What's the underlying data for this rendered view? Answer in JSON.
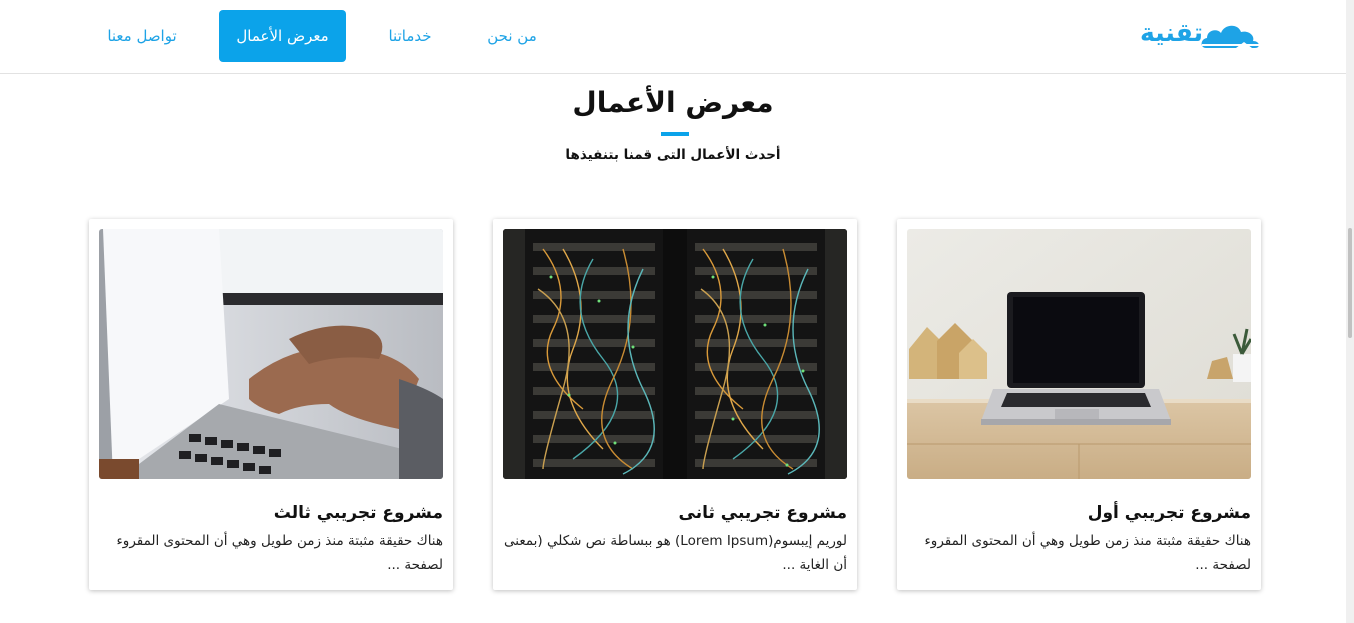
{
  "brand": {
    "name": "تقنية",
    "color": "#1ea3e6"
  },
  "nav": {
    "items": [
      {
        "label": "من نحن",
        "active": false
      },
      {
        "label": "خدماتنا",
        "active": false
      },
      {
        "label": "معرض الأعمال",
        "active": true
      },
      {
        "label": "تواصل معنا",
        "active": false
      }
    ],
    "active_color": "#0ba3ea"
  },
  "section": {
    "title": "معرض الأعمال",
    "subtitle": "أحدث الأعمال التى قمنا بتنفيذها"
  },
  "cards": [
    {
      "title": "مشروع تجريبي أول",
      "text": "هناك حقيقة مثبتة منذ زمن طويل وهي أن المحتوى المقروء لصفحة ...",
      "image": "laptop-on-desk"
    },
    {
      "title": "مشروع تجريبي ثانى",
      "text": "لوريم إيبسوم(Lorem Ipsum) هو ببساطة نص شكلي (بمعنى أن الغاية ...",
      "image": "server-rack"
    },
    {
      "title": "مشروع تجريبي ثالث",
      "text": "هناك حقيقة مثبتة منذ زمن طويل وهي أن المحتوى المقروء لصفحة ...",
      "image": "hands-typing"
    }
  ],
  "icons": {
    "logo": "cloud-icon"
  }
}
